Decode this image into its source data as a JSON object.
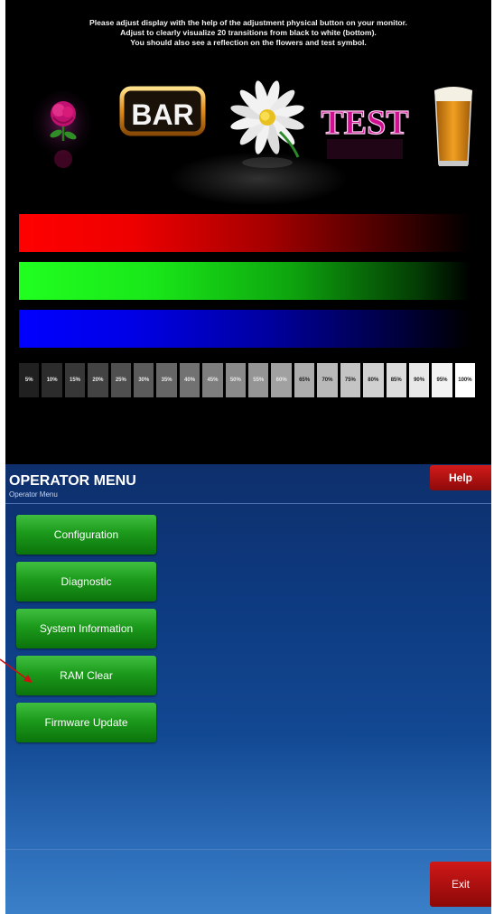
{
  "calibration": {
    "instructions": [
      "Please adjust display with the help of the adjustment physical button on your monitor.",
      "Adjust to clearly visualize 20 transitions from black to white (bottom).",
      "You should also see a reflection on the flowers and test symbol."
    ],
    "symbols": {
      "bar": "BAR",
      "test": "TEST"
    },
    "steps": [
      "5%",
      "10%",
      "15%",
      "20%",
      "25%",
      "30%",
      "35%",
      "40%",
      "45%",
      "50%",
      "55%",
      "60%",
      "65%",
      "70%",
      "75%",
      "80%",
      "85%",
      "90%",
      "95%",
      "100%"
    ]
  },
  "operator_menu": {
    "title": "OPERATOR MENU",
    "subtitle": "Operator Menu",
    "help_label": "Help",
    "items": [
      {
        "label": "Configuration"
      },
      {
        "label": "Diagnostic"
      },
      {
        "label": "System Information"
      },
      {
        "label": "RAM Clear"
      },
      {
        "label": "Firmware Update"
      }
    ],
    "exit_label": "Exit"
  },
  "colors": {
    "panel_top": "#0e2f6c",
    "button_green": "#1c9a1c",
    "button_red": "#b01212",
    "annotation_arrow": "#d01010"
  }
}
